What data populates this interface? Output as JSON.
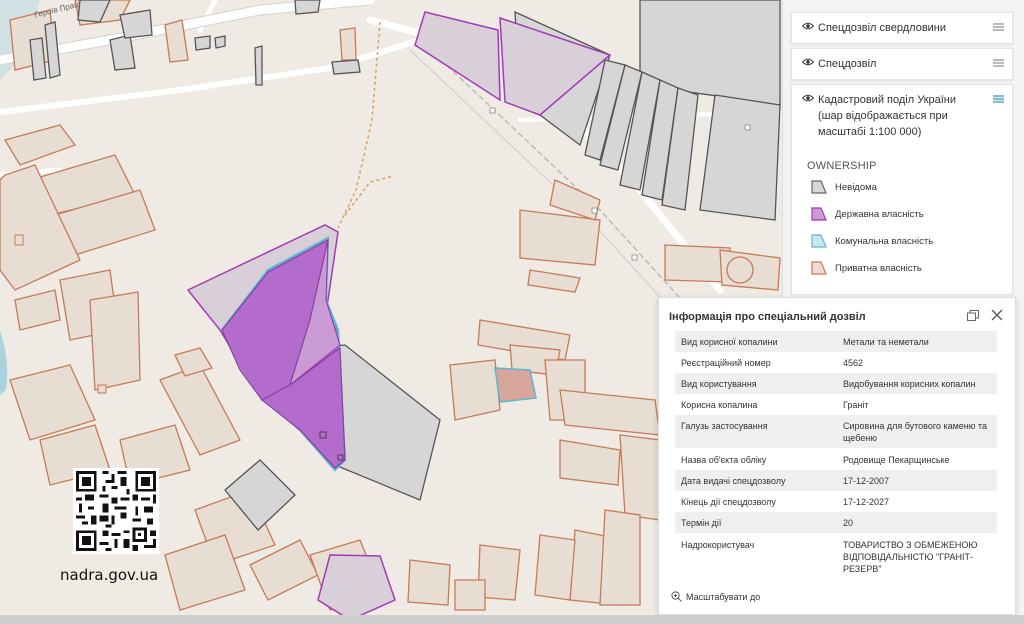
{
  "map": {
    "street_label": "Героїв Праці"
  },
  "layers": [
    {
      "label": "Спецдозвіл свердловини",
      "icon": "eye-icon"
    },
    {
      "label": "Спецдозвіл",
      "icon": "eye-icon"
    },
    {
      "label": "Кадастровий поділ України (шар відображається при масштабі 1:100 000)",
      "icon": "eye-icon"
    }
  ],
  "legend": {
    "title": "OWNERSHIP",
    "items": [
      {
        "label": "Невідома",
        "stroke": "#666666",
        "fill": "#d6d6d6"
      },
      {
        "label": "Державна власність",
        "stroke": "#a33bb5",
        "fill": "#c99ad4"
      },
      {
        "label": "Комунальна власність",
        "stroke": "#5bb8cc",
        "fill": "#c9e6ee"
      },
      {
        "label": "Приватна власність",
        "stroke": "#c77a55",
        "fill": "#ecdcd2"
      }
    ]
  },
  "info_panel": {
    "title": "Інформація про спеціальний дозвіл",
    "rows": [
      {
        "key": "Вид корисної копалини",
        "value": "Метали та неметали"
      },
      {
        "key": "Реєстраційний номер",
        "value": "4562"
      },
      {
        "key": "Вид користування",
        "value": "Видобування корисних копалин"
      },
      {
        "key": "Корисна копалина",
        "value": "Граніт"
      },
      {
        "key": "Галузь застосування",
        "value": "Сировина для бутового каменю та щебеню"
      },
      {
        "key": "Назва об'єкта обліку",
        "value": "Родовище Пекарщинське"
      },
      {
        "key": "Дата видачі спецдозволу",
        "value": "17-12-2007"
      },
      {
        "key": "Кінець дії спецдозволу",
        "value": "17-12-2027"
      },
      {
        "key": "Термін дії",
        "value": "20"
      },
      {
        "key": "Надрокористувач",
        "value": "ТОВАРИСТВО З ОБМЕЖЕНОЮ ВІДПОВІДАЛЬНІСТЮ \"ГРАНІТ-РЕЗЕРВ\""
      }
    ],
    "zoom_label": "Масштабувати до"
  },
  "watermark": {
    "site": "nadra.gov.ua"
  },
  "colors": {
    "accent": "#a33bb5",
    "permit_fill": "#b36ccb",
    "parcel_private": "#c77a55",
    "parcel_unknown": "#666666",
    "water": "#a9d3df"
  }
}
